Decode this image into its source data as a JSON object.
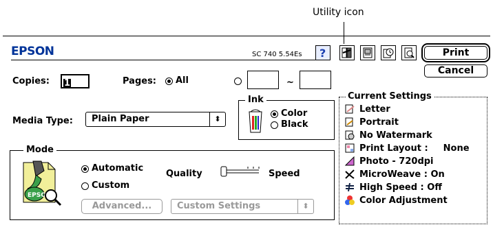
{
  "callout": {
    "label": "Utility icon"
  },
  "header": {
    "brand": "EPSON",
    "version": "SC 740 5.54Es"
  },
  "toolbar": {
    "help_icon": "question-mark-icon",
    "utility_icon": "utility-icon",
    "layout_icon": "layout-icon",
    "background_icon": "background-print-icon",
    "preview_icon": "preview-icon"
  },
  "buttons": {
    "print": "Print",
    "cancel": "Cancel"
  },
  "copies": {
    "label": "Copies:",
    "value": "1"
  },
  "pages": {
    "label": "Pages:",
    "all_label": "All",
    "from": "",
    "to": "",
    "separator": "~"
  },
  "media": {
    "label": "Media Type:",
    "value": "Plain Paper"
  },
  "ink": {
    "group_label": "Ink",
    "color_label": "Color",
    "black_label": "Black",
    "selected": "Color"
  },
  "mode": {
    "group_label": "Mode",
    "automatic_label": "Automatic",
    "custom_label": "Custom",
    "selected": "Automatic",
    "quality_label": "Quality",
    "speed_label": "Speed",
    "advanced_label": "Advanced...",
    "custom_settings_value": "Custom Settings",
    "logo_text": "EPSON"
  },
  "current_settings": {
    "title": "Current Settings",
    "items": [
      {
        "label": "Letter",
        "value": "",
        "icon": "paper-size-icon"
      },
      {
        "label": "Portrait",
        "value": "",
        "icon": "orientation-icon"
      },
      {
        "label": "No Watermark",
        "value": "",
        "icon": "watermark-icon"
      },
      {
        "label": "Print Layout :",
        "value": "None",
        "icon": "print-layout-icon"
      },
      {
        "label": "Photo - 720dpi",
        "value": "",
        "icon": "resolution-icon"
      },
      {
        "label": "MicroWeave : On",
        "value": "",
        "icon": "microweave-icon"
      },
      {
        "label": "High Speed : Off",
        "value": "",
        "icon": "high-speed-icon"
      },
      {
        "label": "Color Adjustment",
        "value": "",
        "icon": "color-adjustment-icon"
      }
    ]
  },
  "colors": {
    "accent": "#003399",
    "dim": "#999999"
  }
}
